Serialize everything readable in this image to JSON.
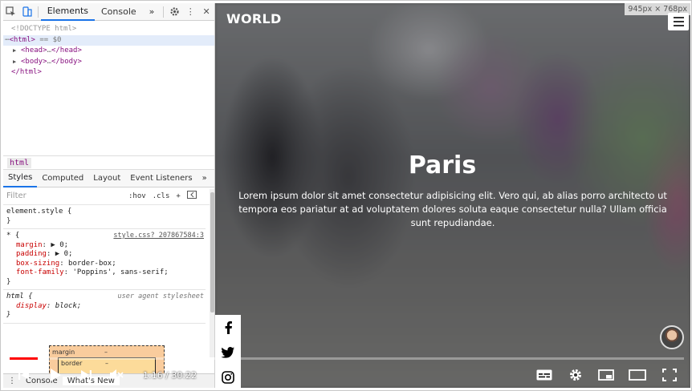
{
  "devtools": {
    "tabs": [
      {
        "label": "Elements",
        "active": true
      },
      {
        "label": "Console",
        "active": false
      }
    ],
    "more_tabs_glyph": "»",
    "dom": {
      "doctype": "<!DOCTYPE html>",
      "html_open": "html",
      "html_suffix": "== $0",
      "head": "head",
      "body": "body",
      "ellipsis": "…",
      "html_close": "html"
    },
    "breadcrumb": "html",
    "styles_tabs": [
      "Styles",
      "Computed",
      "Layout",
      "Event Listeners"
    ],
    "filter_placeholder": "Filter",
    "filter_tools": [
      ":hov",
      ".cls",
      "+"
    ],
    "rules": {
      "element_style": {
        "selector": "element.style {",
        "close": "}"
      },
      "universal": {
        "selector": "* {",
        "source": "style.css?_207867584:3",
        "props": [
          {
            "name": "margin",
            "value": "▶ 0;"
          },
          {
            "name": "padding",
            "value": "▶ 0;"
          },
          {
            "name": "box-sizing",
            "value": "border-box;"
          },
          {
            "name": "font-family",
            "value": "'Poppins', sans-serif;"
          }
        ],
        "close": "}"
      },
      "html_ua": {
        "selector": "html {",
        "source": "user agent stylesheet",
        "props": [
          {
            "name": "display",
            "value": "block;"
          }
        ],
        "close": "}"
      }
    },
    "box_model": {
      "margin_label": "margin",
      "border_label": "border",
      "dash": "–"
    },
    "drawer_tabs": [
      "Console",
      "What's New"
    ]
  },
  "page": {
    "logo": "WORLD",
    "dimensions": "945px × 768px",
    "title": "Paris",
    "description": "Lorem ipsum dolor sit amet consectetur adipisicing elit. Vero qui, ab alias porro architecto ut tempora eos pariatur at ad voluptatem dolores soluta eaque consectetur nulla? Ullam officia sunt repudiandae.",
    "social_icons": [
      "facebook-icon",
      "twitter-icon",
      "instagram-icon"
    ]
  },
  "player": {
    "current_time": "1:16",
    "duration": "30:22",
    "time_display": "1:16 / 30:22",
    "progress_fraction": 0.042,
    "accent_color": "#ff0000"
  }
}
